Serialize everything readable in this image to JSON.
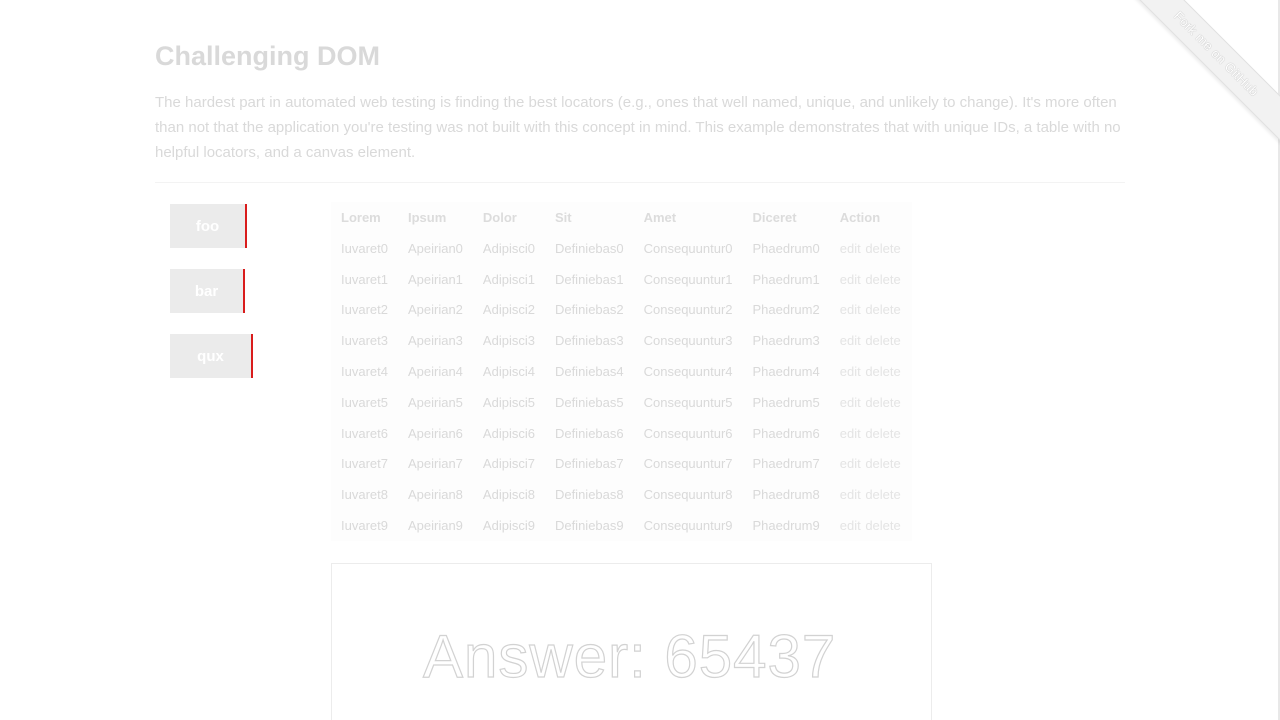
{
  "page": {
    "title": "Challenging DOM",
    "intro": "The hardest part in automated web testing is finding the best locators (e.g., ones that well named, unique, and unlikely to change). It's more often than not that the application you're testing was not built with this concept in mind. This example demonstrates that with unique IDs, a table with no helpful locators, and a canvas element."
  },
  "ribbon": {
    "label": "Fork me on GitHub"
  },
  "buttons": [
    {
      "label": "foo"
    },
    {
      "label": "bar"
    },
    {
      "label": "qux"
    }
  ],
  "table": {
    "headers": [
      "Lorem",
      "Ipsum",
      "Dolor",
      "Sit",
      "Amet",
      "Diceret",
      "Action"
    ],
    "rows": [
      [
        "Iuvaret0",
        "Apeirian0",
        "Adipisci0",
        "Definiebas0",
        "Consequuntur0",
        "Phaedrum0"
      ],
      [
        "Iuvaret1",
        "Apeirian1",
        "Adipisci1",
        "Definiebas1",
        "Consequuntur1",
        "Phaedrum1"
      ],
      [
        "Iuvaret2",
        "Apeirian2",
        "Adipisci2",
        "Definiebas2",
        "Consequuntur2",
        "Phaedrum2"
      ],
      [
        "Iuvaret3",
        "Apeirian3",
        "Adipisci3",
        "Definiebas3",
        "Consequuntur3",
        "Phaedrum3"
      ],
      [
        "Iuvaret4",
        "Apeirian4",
        "Adipisci4",
        "Definiebas4",
        "Consequuntur4",
        "Phaedrum4"
      ],
      [
        "Iuvaret5",
        "Apeirian5",
        "Adipisci5",
        "Definiebas5",
        "Consequuntur5",
        "Phaedrum5"
      ],
      [
        "Iuvaret6",
        "Apeirian6",
        "Adipisci6",
        "Definiebas6",
        "Consequuntur6",
        "Phaedrum6"
      ],
      [
        "Iuvaret7",
        "Apeirian7",
        "Adipisci7",
        "Definiebas7",
        "Consequuntur7",
        "Phaedrum7"
      ],
      [
        "Iuvaret8",
        "Apeirian8",
        "Adipisci8",
        "Definiebas8",
        "Consequuntur8",
        "Phaedrum8"
      ],
      [
        "Iuvaret9",
        "Apeirian9",
        "Adipisci9",
        "Definiebas9",
        "Consequuntur9",
        "Phaedrum9"
      ]
    ],
    "action_edit": "edit",
    "action_delete": "delete"
  },
  "canvas": {
    "prefix": "Answer: ",
    "number": "65437"
  },
  "colors": {
    "accent_red": "#d91c1c",
    "faded_text": "#d9d9d9",
    "button_bg": "#ebebeb"
  }
}
